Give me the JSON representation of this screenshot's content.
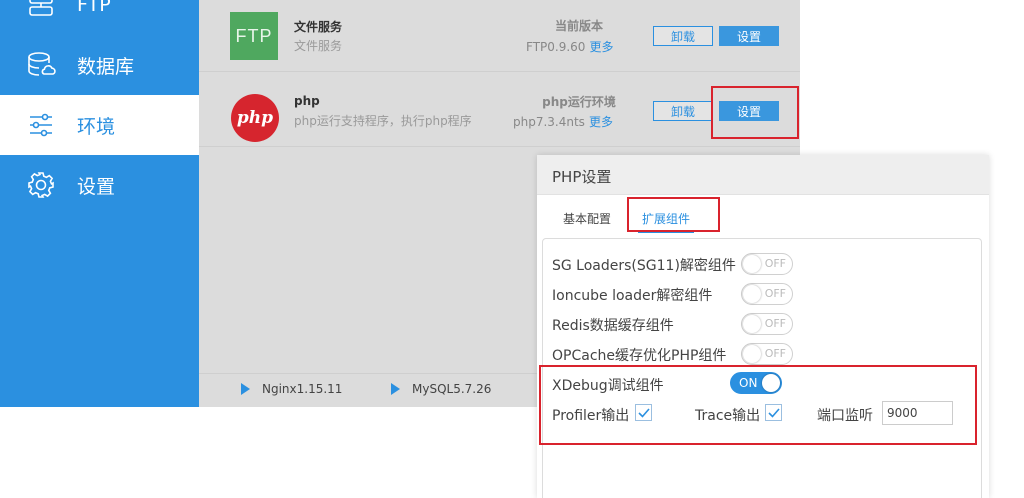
{
  "sidebar": {
    "items": [
      {
        "label": "FTP",
        "icon": "ftp-icon"
      },
      {
        "label": "数据库",
        "icon": "database-icon"
      },
      {
        "label": "环境",
        "icon": "sliders-icon",
        "active": true
      },
      {
        "label": "设置",
        "icon": "gear-icon"
      }
    ]
  },
  "software_list": [
    {
      "logo_text": "FTP",
      "name": "文件服务",
      "description": "文件服务",
      "version_title": "当前版本",
      "version": "FTP0.9.60",
      "more": "更多",
      "uninstall": "卸载",
      "settings": "设置"
    },
    {
      "logo_text": "php",
      "name": "php",
      "description": "php运行支持程序，执行php程序",
      "version_title": "php运行环境",
      "version": "php7.3.4nts",
      "more": "更多",
      "uninstall": "卸载",
      "settings": "设置"
    }
  ],
  "footer": {
    "items": [
      "Nginx1.15.11",
      "MySQL5.7.26"
    ]
  },
  "dialog": {
    "title": "PHP设置",
    "tabs": [
      "基本配置",
      "扩展组件"
    ],
    "active_tab": "扩展组件",
    "options": [
      {
        "label": "SG Loaders(SG11)解密组件",
        "state": "OFF"
      },
      {
        "label": "Ioncube loader解密组件",
        "state": "OFF"
      },
      {
        "label": "Redis数据缓存组件",
        "state": "OFF"
      },
      {
        "label": "OPCache缓存优化PHP组件",
        "state": "OFF"
      },
      {
        "label": "XDebug调试组件",
        "state": "ON"
      }
    ],
    "profiler_label": "Profiler输出",
    "trace_label": "Trace输出",
    "port_label": "端口监听",
    "port_value": "9000"
  },
  "colors": {
    "accent": "#2b90e0",
    "highlight": "#d9232d",
    "ftp_logo": "#4fa85f",
    "php_logo": "#d6252e"
  }
}
